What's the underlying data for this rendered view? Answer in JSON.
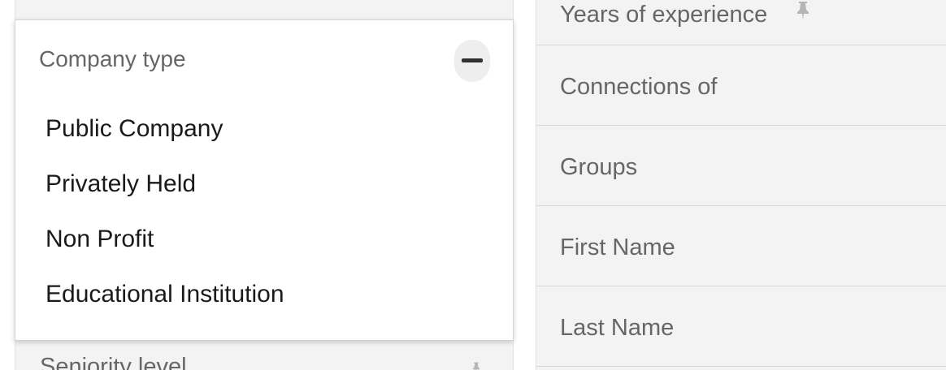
{
  "left_panel": {
    "company_type": {
      "title": "Company type",
      "collapse_icon": "minus-icon",
      "options": [
        "Public Company",
        "Privately Held",
        "Non Profit",
        "Educational Institution"
      ]
    },
    "partial_item_label": "Seniority level",
    "partial_item_icon": "pin-icon"
  },
  "right_panel": {
    "items": [
      {
        "label": "Years of experience",
        "icon": "pin-icon"
      },
      {
        "label": "Connections of"
      },
      {
        "label": "Groups"
      },
      {
        "label": "First Name"
      },
      {
        "label": "Last Name"
      }
    ]
  },
  "colors": {
    "panel_bg": "#f3f3f4",
    "card_bg": "#ffffff",
    "muted_text": "#666666",
    "option_text": "#1a1a1a"
  }
}
